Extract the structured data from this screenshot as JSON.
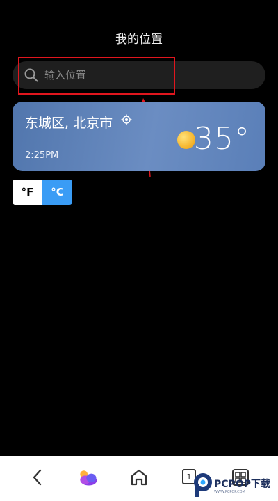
{
  "header": {
    "title": "我的位置"
  },
  "search": {
    "placeholder": "输入位置",
    "value": ""
  },
  "weather_card": {
    "city": "东城区, 北京市",
    "time": "2:25PM",
    "temperature": "35°",
    "condition_icon": "sun-icon",
    "locate_icon": "locate-icon"
  },
  "unit_toggle": {
    "fahrenheit_label": "°F",
    "celsius_label": "°C",
    "selected": "°C"
  },
  "bottom_nav": {
    "items": [
      {
        "icon": "back-icon"
      },
      {
        "icon": "weather-app-icon"
      },
      {
        "icon": "home-icon"
      },
      {
        "icon": "tabs-icon",
        "count": "1"
      },
      {
        "icon": "grid-menu-icon"
      }
    ]
  },
  "watermark": {
    "text": "PCPOP下载",
    "subtext": "WWW.PCPOP.COM"
  },
  "colors": {
    "background": "#000000",
    "search_bg": "#1f1f1f",
    "card_gradient_start": "#5176ad",
    "card_gradient_end": "#6b8dc2",
    "celsius_active": "#3a9cf5",
    "annotation_red": "#e0161e",
    "nav_bg": "#ffffff"
  }
}
